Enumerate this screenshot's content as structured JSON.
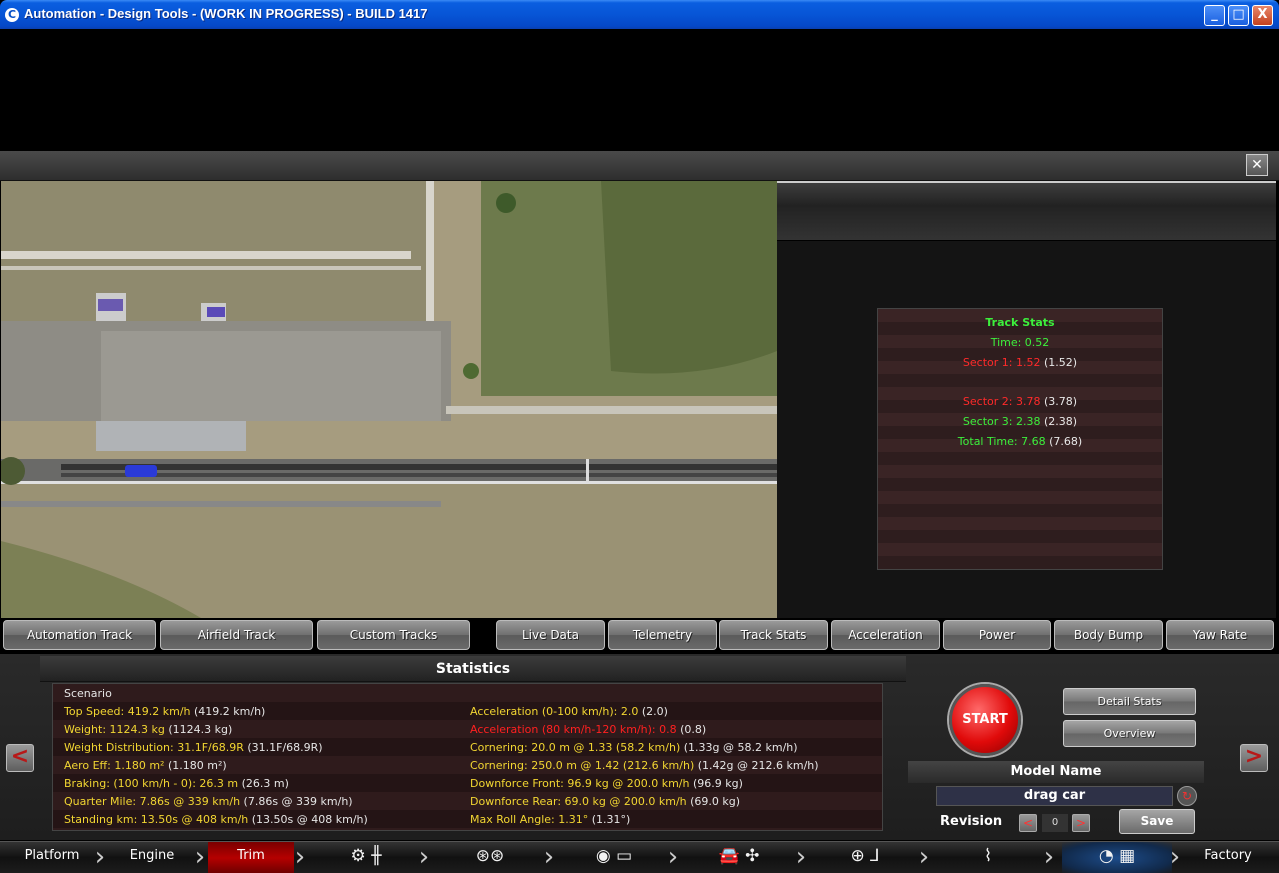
{
  "window": {
    "title": "Automation - Design Tools - (WORK IN PROGRESS) - BUILD 1417",
    "minimize": "_",
    "maximize": "□",
    "close": "X"
  },
  "view": {
    "close": "✕"
  },
  "track_stats": {
    "title": "Track Stats",
    "time": "Time: 0.52",
    "sector1_label": "Sector 1: 1.52",
    "sector1_best": "(1.52)",
    "sector2_label": "Sector 2: 3.78",
    "sector2_best": "(3.78)",
    "sector3_label": "Sector 3: 2.38",
    "sector3_best": "(2.38)",
    "total_label": "Total Time: 7.68",
    "total_best": "(7.68)"
  },
  "track_tabs": [
    "Automation Track",
    "Airfield Track",
    "Custom Tracks"
  ],
  "data_tabs": [
    "Live Data",
    "Telemetry",
    "Track Stats",
    "Acceleration",
    "Power",
    "Body Bump",
    "Yaw Rate"
  ],
  "statistics": {
    "title": "Statistics",
    "scenario": "Scenario",
    "left": [
      {
        "label": "Top Speed: 419.2 km/h",
        "ref": "(419.2 km/h)"
      },
      {
        "label": "Weight: 1124.3 kg",
        "ref": "(1124.3 kg)"
      },
      {
        "label": "Weight Distribution: 31.1F/68.9R",
        "ref": "(31.1F/68.9R)"
      },
      {
        "label": "Aero Eff: 1.180 m²",
        "ref": "(1.180 m²)"
      },
      {
        "label": "Braking: (100 km/h - 0): 26.3 m",
        "ref": "(26.3 m)"
      },
      {
        "label": "Quarter Mile: 7.86s @ 339 km/h",
        "ref": "(7.86s @ 339 km/h)"
      },
      {
        "label": "Standing km: 13.50s @ 408 km/h",
        "ref": "(13.50s @ 408 km/h)"
      }
    ],
    "right": [
      {
        "label": "Acceleration (0-100 km/h): 2.0",
        "ref": "(2.0)"
      },
      {
        "label": "Acceleration (80 km/h-120 km/h): 0.8",
        "ref": "(0.8)"
      },
      {
        "label": "Cornering: 20.0 m @ 1.33 (58.2 km/h)",
        "ref": "(1.33g @ 58.2 km/h)"
      },
      {
        "label": "Cornering: 250.0 m @ 1.42 (212.6 km/h)",
        "ref": "(1.42g @ 212.6 km/h)"
      },
      {
        "label": "Downforce Front: 96.9 kg @ 200.0 km/h",
        "ref": "(96.9 kg)"
      },
      {
        "label": "Downforce Rear: 69.0 kg @ 200.0 km/h",
        "ref": "(69.0 kg)"
      },
      {
        "label": "Max Roll Angle: 1.31°",
        "ref": "(1.31°)"
      }
    ]
  },
  "controls": {
    "start": "START",
    "detail_stats": "Detail Stats",
    "overview": "Overview",
    "model_name_label": "Model Name",
    "model_name_value": "drag car",
    "revision_label": "Revision",
    "revision_value": "0",
    "rev_prev": "<",
    "rev_next": ">",
    "save": "Save",
    "prev": "<",
    "next": ">",
    "refresh": "↻"
  },
  "nav": {
    "platform": "Platform",
    "engine": "Engine",
    "trim": "Trim",
    "factory": "Factory",
    "icons": [
      "gear-shifter-icon",
      "wheels-icon",
      "brake-body-icon",
      "car-fan-icon",
      "steering-seat-icon",
      "suspension-icon",
      "test-flag-icon"
    ]
  },
  "colors": {
    "stat_yellow": "#f2d632",
    "stat_red": "#ff2020",
    "track_green": "#3cf03c",
    "nav_active": "#b50000"
  }
}
